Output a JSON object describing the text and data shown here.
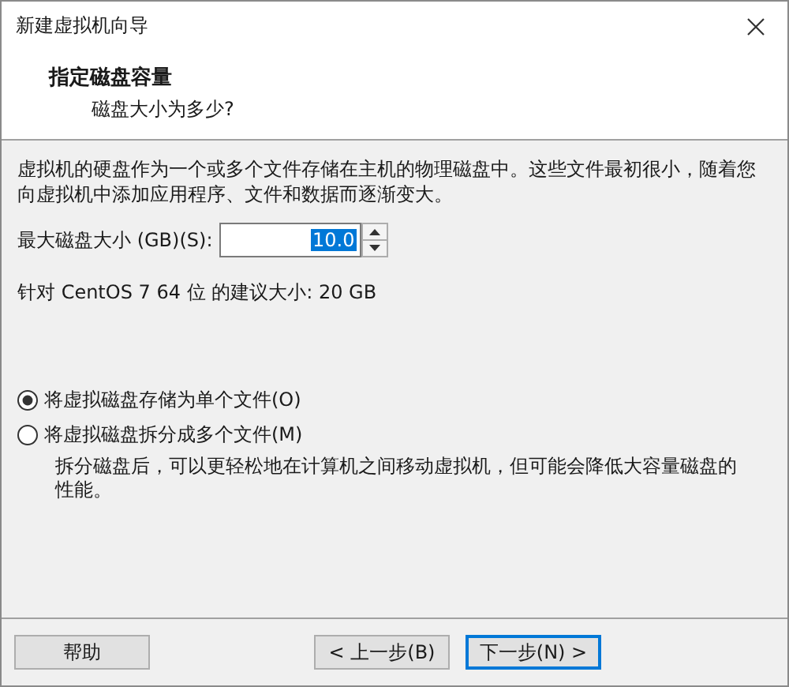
{
  "window": {
    "title": "新建虚拟机向导"
  },
  "header": {
    "title": "指定磁盘容量",
    "subtitle": "磁盘大小为多少?"
  },
  "description": "虚拟机的硬盘作为一个或多个文件存储在主机的物理磁盘中。这些文件最初很小，随着您向虚拟机中添加应用程序、文件和数据而逐渐变大。",
  "disk_size": {
    "label": "最大磁盘大小 (GB)(S):",
    "value": "10.0"
  },
  "recommendation": "针对 CentOS 7 64 位 的建议大小: 20 GB",
  "options": [
    {
      "label": "将虚拟磁盘存储为单个文件(O)",
      "selected": true
    },
    {
      "label": "将虚拟磁盘拆分成多个文件(M)",
      "selected": false,
      "note": "拆分磁盘后，可以更轻松地在计算机之间移动虚拟机，但可能会降低大容量磁盘的性能。"
    }
  ],
  "buttons": {
    "help": "帮助",
    "back": "< 上一步(B)",
    "next": "下一步(N) >"
  }
}
